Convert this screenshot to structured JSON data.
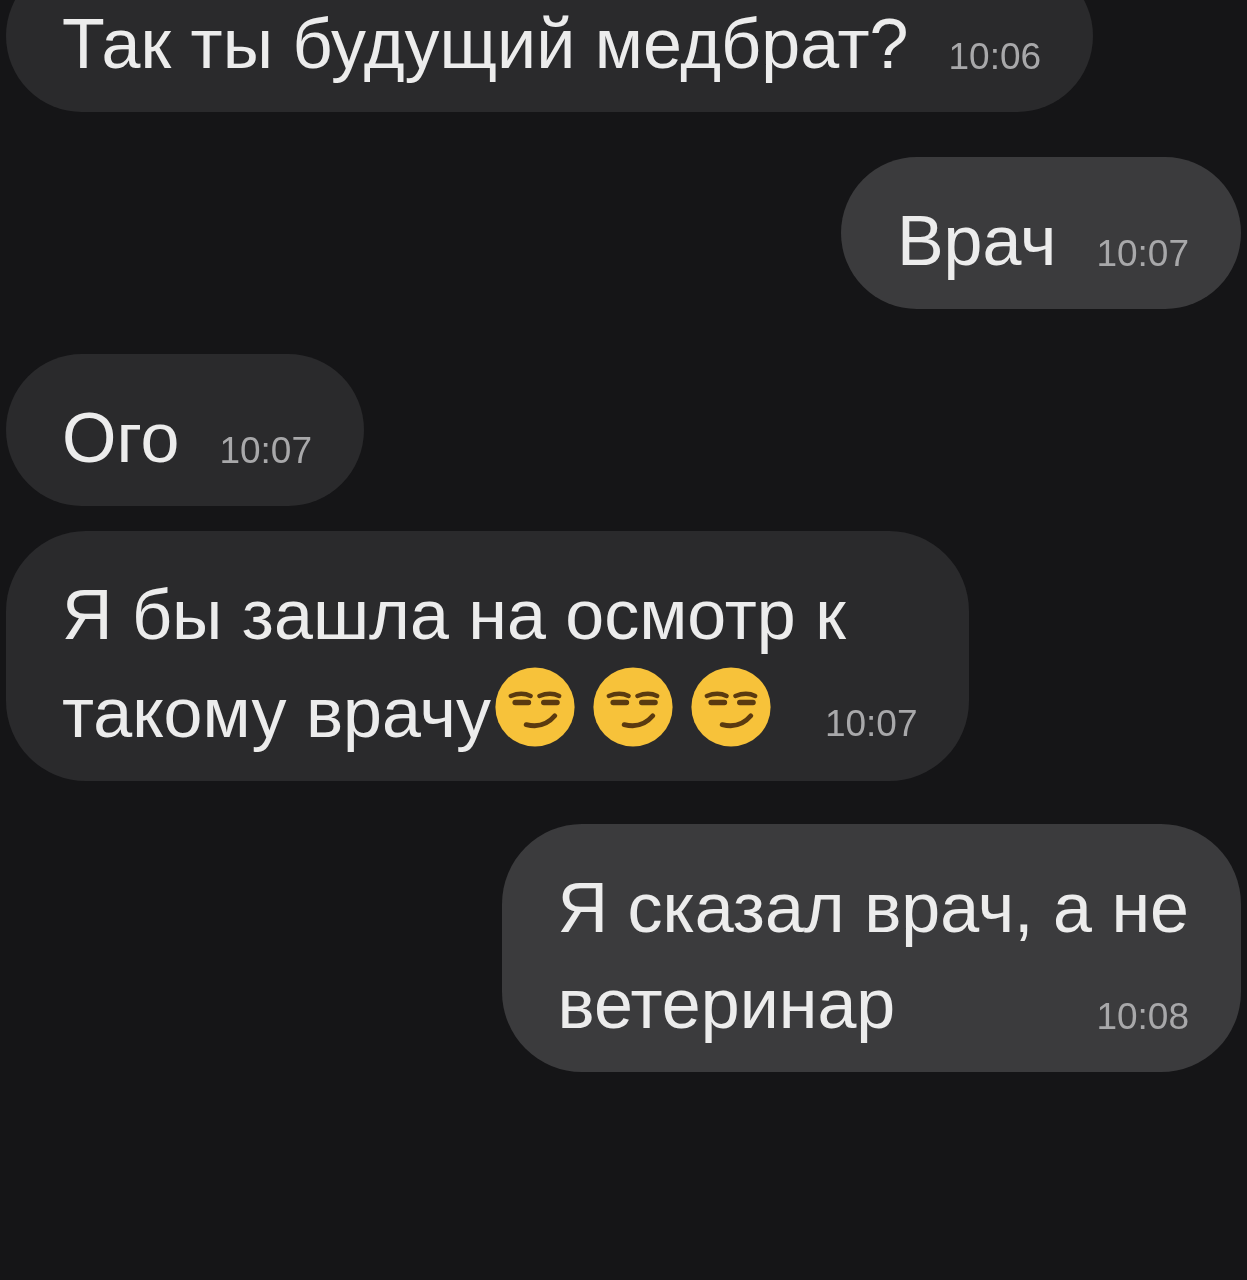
{
  "messages": [
    {
      "kind": "incoming",
      "lines": [
        "Так ты будущий медбрат?"
      ],
      "time": "10:06"
    },
    {
      "kind": "outgoing",
      "lines": [
        "Врач"
      ],
      "time": "10:07"
    },
    {
      "kind": "incoming",
      "lines": [
        "Ого"
      ],
      "time": "10:07"
    },
    {
      "kind": "incoming",
      "lines": [
        "Я бы зашла на осмотр к",
        "такому врачу"
      ],
      "emojis": [
        {
          "kind": "smirk"
        },
        {
          "kind": "smirk"
        },
        {
          "kind": "smirk"
        }
      ],
      "time": "10:07"
    },
    {
      "kind": "outgoing",
      "lines": [
        "Я сказал врач, а не",
        "ветеринар"
      ],
      "time": "10:08"
    }
  ]
}
